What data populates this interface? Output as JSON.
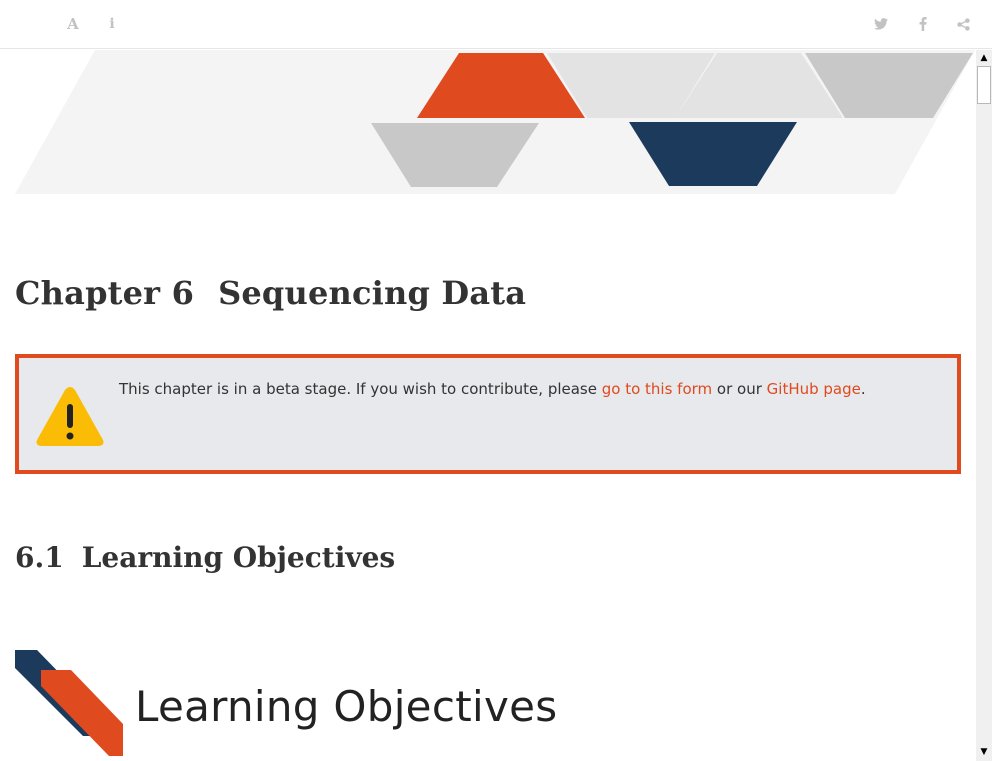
{
  "toolbar": {
    "font_icon": "font-settings-icon",
    "info_icon": "info-icon",
    "twitter_icon": "twitter-icon",
    "facebook_icon": "facebook-icon",
    "share_icon": "share-icon",
    "font_glyph": "A",
    "info_glyph": "i"
  },
  "chapter": {
    "number": "Chapter 6",
    "title": "Sequencing Data"
  },
  "callout": {
    "text_before": "This chapter is in a beta stage. If you wish to contribute, please ",
    "link1": "go to this form",
    "text_middle": " or our ",
    "link2": "GitHub page",
    "text_after": ".",
    "border_color": "#e04a1f",
    "icon": "warning-icon"
  },
  "section": {
    "number": "6.1",
    "title": "Learning Objectives"
  },
  "learning_banner": {
    "text": "Learning Objectives"
  },
  "colors": {
    "accent_orange": "#e04a1f",
    "accent_navy": "#1b3a5c",
    "light_gray": "#e3e3e3",
    "mid_gray": "#c8c8c8"
  }
}
